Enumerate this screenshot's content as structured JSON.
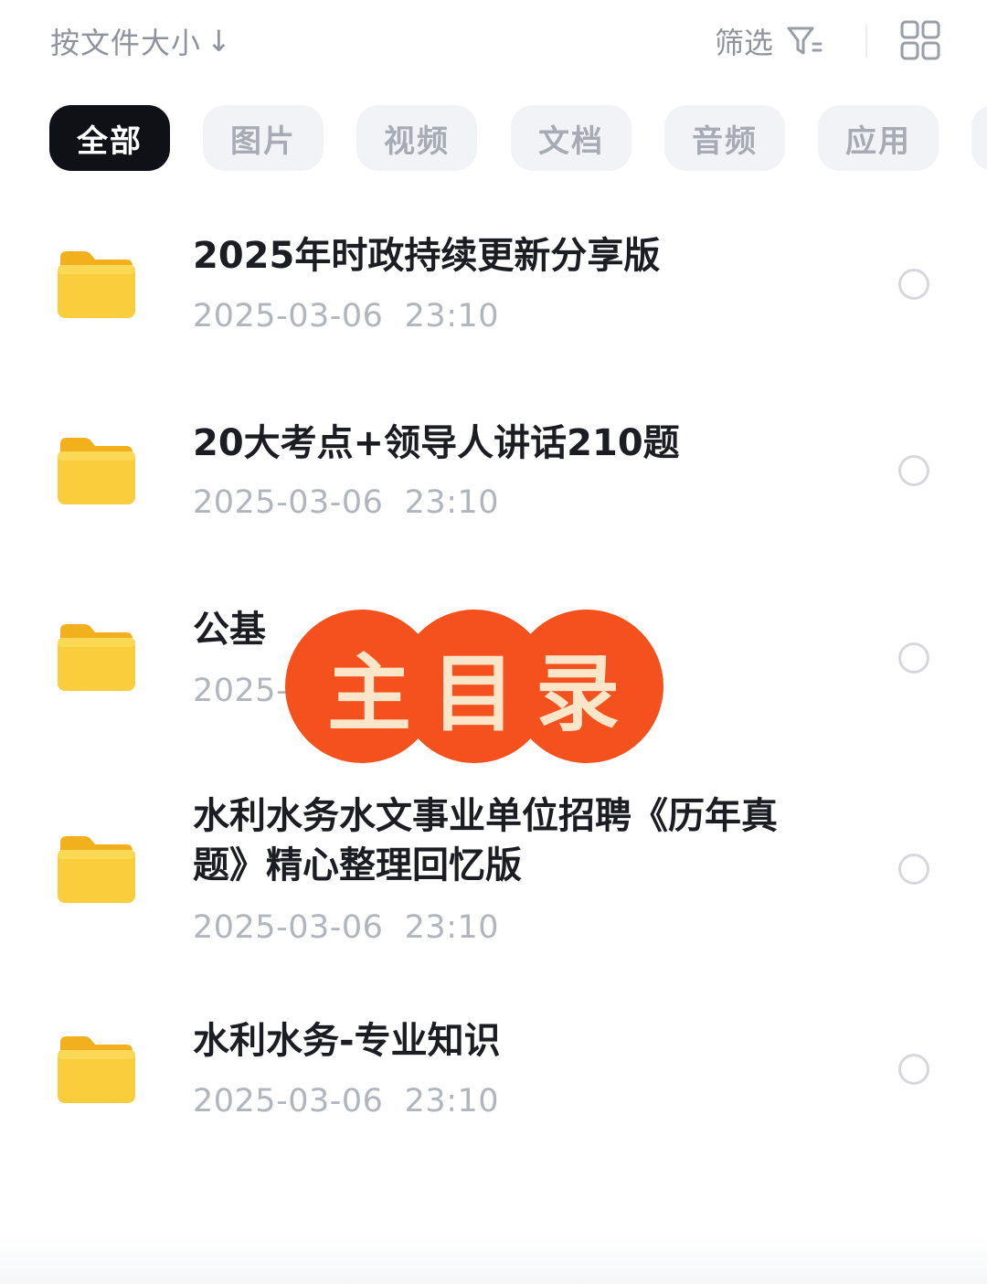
{
  "header": {
    "sort_label": "按文件大小",
    "sort_arrow": "↓",
    "filter_label": "筛选"
  },
  "tabs": [
    {
      "label": "全部",
      "active": true
    },
    {
      "label": "图片",
      "active": false
    },
    {
      "label": "视频",
      "active": false
    },
    {
      "label": "文档",
      "active": false
    },
    {
      "label": "音频",
      "active": false
    },
    {
      "label": "应用",
      "active": false
    }
  ],
  "files": [
    {
      "name": "2025年时政持续更新分享版",
      "date": "2025-03-06  23:10",
      "icon": "folder-icon"
    },
    {
      "name": "20大考点+领导人讲话210题",
      "date": "2025-03-06  23:10",
      "icon": "folder-icon"
    },
    {
      "name": "公基",
      "date": "2025-03-06  23:10",
      "icon": "folder-icon"
    },
    {
      "name": "水利水务水文事业单位招聘《历年真题》精心整理回忆版",
      "date": "2025-03-06  23:10",
      "icon": "folder-icon"
    },
    {
      "name": "水利水务-专业知识",
      "date": "2025-03-06  23:10",
      "icon": "folder-icon"
    }
  ],
  "overlay": {
    "text": "主目录"
  },
  "colors": {
    "folder": "#f8c830",
    "active_tab": "#0f1117",
    "overlay_red": "#f4511e",
    "overlay_text": "#fbe6c9"
  }
}
